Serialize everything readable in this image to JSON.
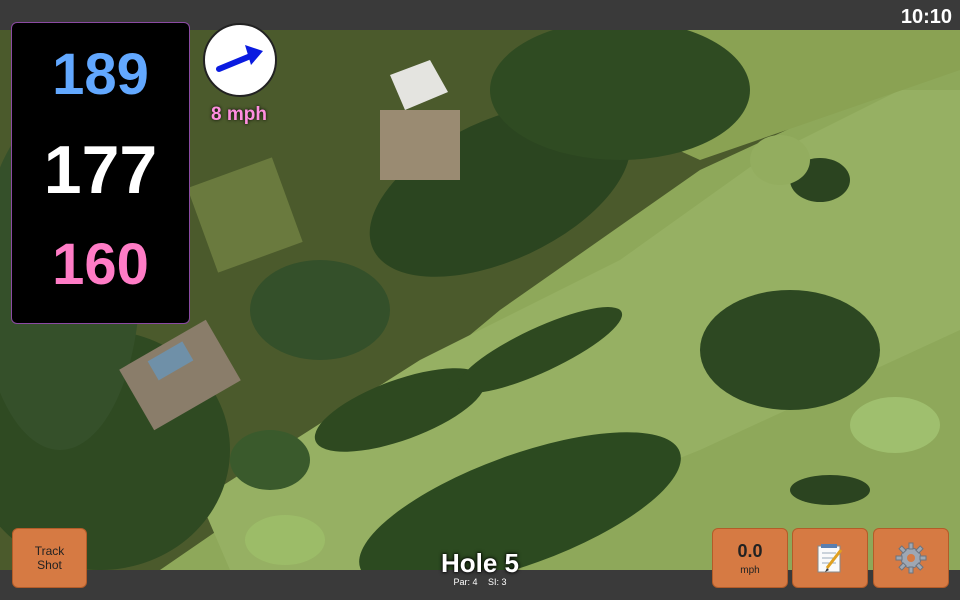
{
  "status": {
    "clock": "10:10"
  },
  "distances": {
    "back": "189",
    "middle": "177",
    "front": "160"
  },
  "wind": {
    "speed": "8 mph",
    "icon": "wind-arrow-icon"
  },
  "buttons": {
    "track_line1": "Track",
    "track_line2": "Shot",
    "speed_value": "0.0",
    "speed_unit": "mph",
    "notes_icon": "notepad-icon",
    "settings_icon": "gear-icon"
  },
  "hole": {
    "title": "Hole 5",
    "par": "Par: 4",
    "si": "SI: 3"
  },
  "colors": {
    "back": "#62a8ff",
    "middle": "#ffffff",
    "front": "#ff7cc6",
    "button": "#d67a43",
    "accent": "#a64fbf"
  }
}
